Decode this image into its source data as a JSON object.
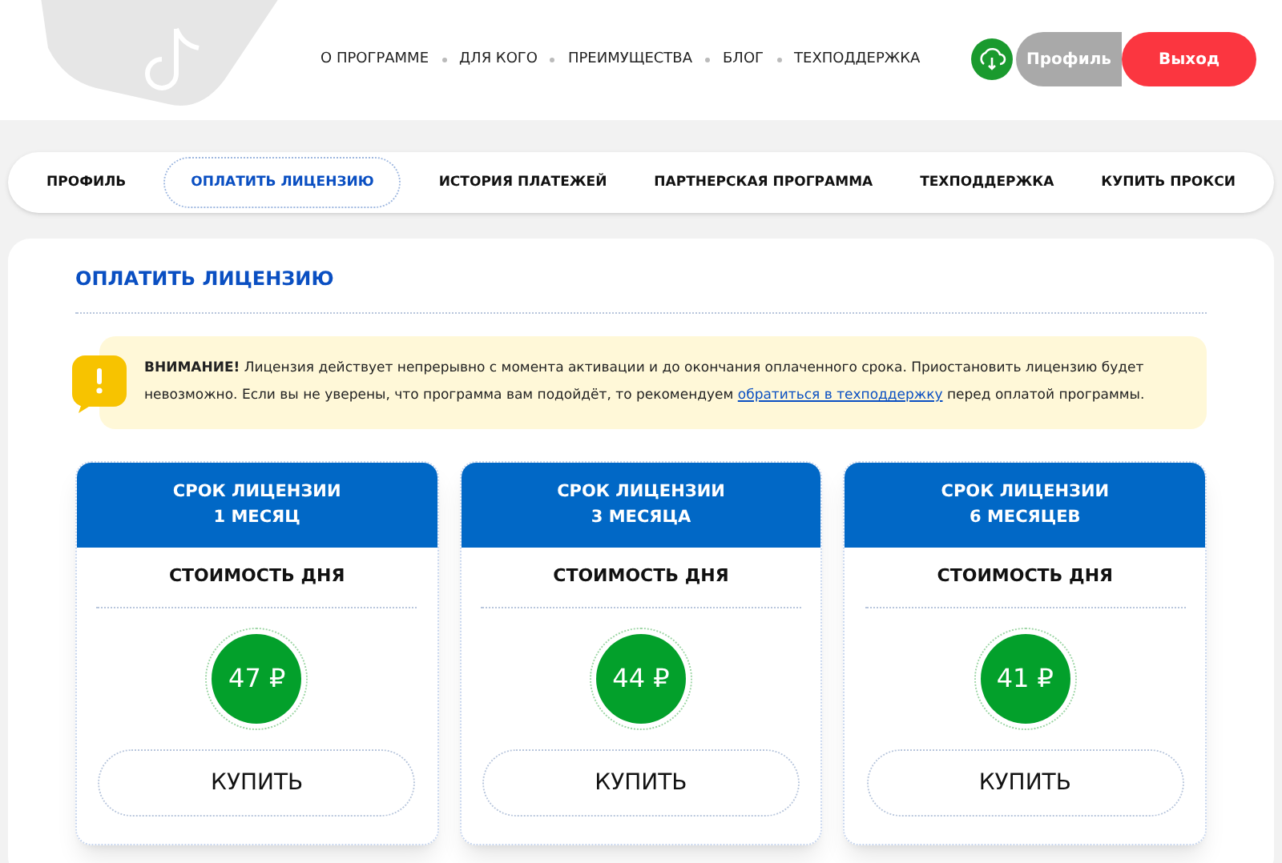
{
  "nav": [
    "О ПРОГРАММЕ",
    "ДЛЯ КОГО",
    "ПРЕИМУЩЕСТВА",
    "БЛОГ",
    "ТЕХПОДДЕРЖКА"
  ],
  "account": {
    "profile": "Профиль",
    "logout": "Выход"
  },
  "tabs": [
    {
      "label": "ПРОФИЛЬ",
      "selected": false
    },
    {
      "label": "ОПЛАТИТЬ ЛИЦЕНЗИЮ",
      "selected": true
    },
    {
      "label": "ИСТОРИЯ ПЛАТЕЖЕЙ",
      "selected": false
    },
    {
      "label": "ПАРТНЕРСКАЯ ПРОГРАММА",
      "selected": false
    },
    {
      "label": "ТЕХПОДДЕРЖКА",
      "selected": false
    },
    {
      "label": "КУПИТЬ ПРОКСИ",
      "selected": false
    }
  ],
  "section_title": "ОПЛАТИТЬ ЛИЦЕНЗИЮ",
  "notice": {
    "text": "**ВНИМАНИЕ!** Лицензия действует непрерывно с момента активации и до окончания оплаченного срока. Приостановить лицензию будет невозможно. Если вы не уверены, что программа вам подойдёт, то рекомендуем",
    "link": "обратиться в техподдержку",
    "text_after": "перед оплатой программы."
  },
  "plans": [
    {
      "title": "СРОК ЛИЦЕНЗИИ",
      "term": "1 МЕСЯЦ",
      "label": "СТОИМОСТЬ ДНЯ",
      "price": "47 ₽",
      "button": "КУПИТЬ"
    },
    {
      "title": "СРОК ЛИЦЕНЗИИ",
      "term": "3 МЕСЯЦА",
      "label": "СТОИМОСТЬ ДНЯ",
      "price": "44 ₽",
      "button": "КУПИТЬ"
    },
    {
      "title": "СРОК ЛИЦЕНЗИИ",
      "term": "6 МЕСЯЦЕВ",
      "label": "СТОИМОСТЬ ДНЯ",
      "price": "41 ₽",
      "button": "КУПИТЬ"
    }
  ]
}
